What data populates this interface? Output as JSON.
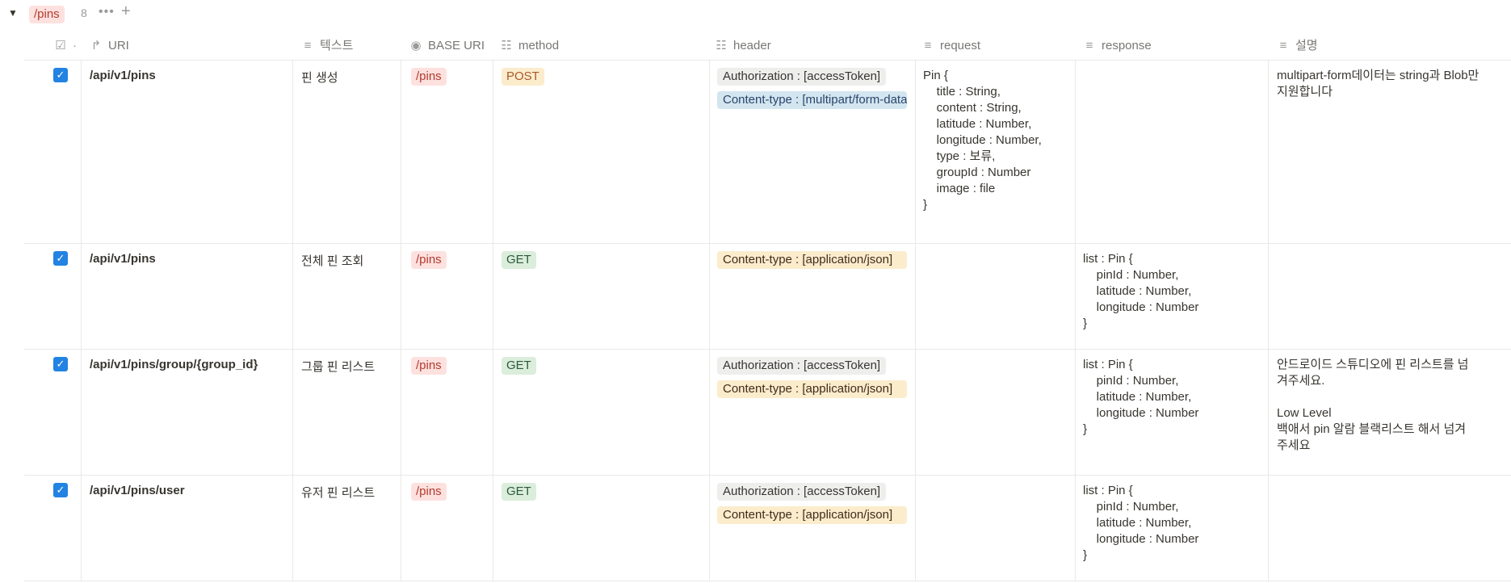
{
  "group": {
    "title": "/pins",
    "count": "8",
    "toggle_icon": "triangle-down",
    "more_icon": "ellipsis",
    "add_icon": "plus"
  },
  "columns": [
    {
      "icon": "checkbox-icon",
      "glyph": "☑",
      "label": ""
    },
    {
      "icon": "relation-arrow-icon",
      "glyph": "↱",
      "label": "URI"
    },
    {
      "icon": "text-lines-icon",
      "glyph": "≡",
      "label": "텍스트"
    },
    {
      "icon": "select-icon",
      "glyph": "◉",
      "label": "BASE URI"
    },
    {
      "icon": "list-icon",
      "glyph": "☷",
      "label": "method"
    },
    {
      "icon": "list-icon",
      "glyph": "☷",
      "label": "header"
    },
    {
      "icon": "text-lines-icon",
      "glyph": "≡",
      "label": "request"
    },
    {
      "icon": "text-lines-icon",
      "glyph": "≡",
      "label": "response"
    },
    {
      "icon": "text-lines-icon",
      "glyph": "≡",
      "label": "설명"
    }
  ],
  "rows": [
    {
      "checked": true,
      "uri": "/api/v1/pins",
      "text": "핀 생성",
      "base_uri": "/pins",
      "method": "POST",
      "headers": [
        "Authorization : [accessToken]",
        "Content-type : [multipart/form-data]"
      ],
      "request": "Pin {\n    title : String,\n    content : String,\n    latitude : Number,\n    longitude : Number,\n    type : 보류,\n    groupId : Number\n    image : file\n}",
      "response": "",
      "description": [
        "multipart-form데이터는 string과 Blob만",
        "지원합니다"
      ]
    },
    {
      "checked": true,
      "uri": "/api/v1/pins",
      "text": "전체 핀 조회",
      "base_uri": "/pins",
      "method": "GET",
      "headers": [
        "Content-type : [application/json]"
      ],
      "request": "",
      "response": "list : Pin {\n    pinId : Number,\n    latitude : Number,\n    longitude : Number\n}",
      "description": []
    },
    {
      "checked": true,
      "uri": "/api/v1/pins/group/{group_id}",
      "text": "그룹 핀 리스트",
      "base_uri": "/pins",
      "method": "GET",
      "headers": [
        "Authorization : [accessToken]",
        "Content-type : [application/json]"
      ],
      "request": "",
      "response": "list : Pin {\n    pinId : Number,\n    latitude : Number,\n    longitude : Number\n}",
      "description": [
        "안드로이드 스튜디오에 핀 리스트를 넘",
        "겨주세요.",
        "",
        "Low Level",
        "백애서 pin 알람 블랙리스트 해서 넘겨",
        "주세요"
      ]
    },
    {
      "checked": true,
      "uri": "/api/v1/pins/user",
      "text": "유저 핀 리스트",
      "base_uri": "/pins",
      "method": "GET",
      "headers": [
        "Authorization : [accessToken]",
        "Content-type : [application/json]"
      ],
      "request": "",
      "response": "list : Pin {\n    pinId : Number,\n    latitude : Number,\n    longitude : Number\n}",
      "description": []
    }
  ],
  "colors": {
    "checkbox": "#2383e2",
    "tag_pins_bg": "#fde1df",
    "tag_post_bg": "#fbeccc",
    "tag_get_bg": "#dbeddb",
    "header_auth_bg": "#eeeeec",
    "header_multipart_bg": "#d3e5ef",
    "header_json_bg": "#fbeccc"
  }
}
